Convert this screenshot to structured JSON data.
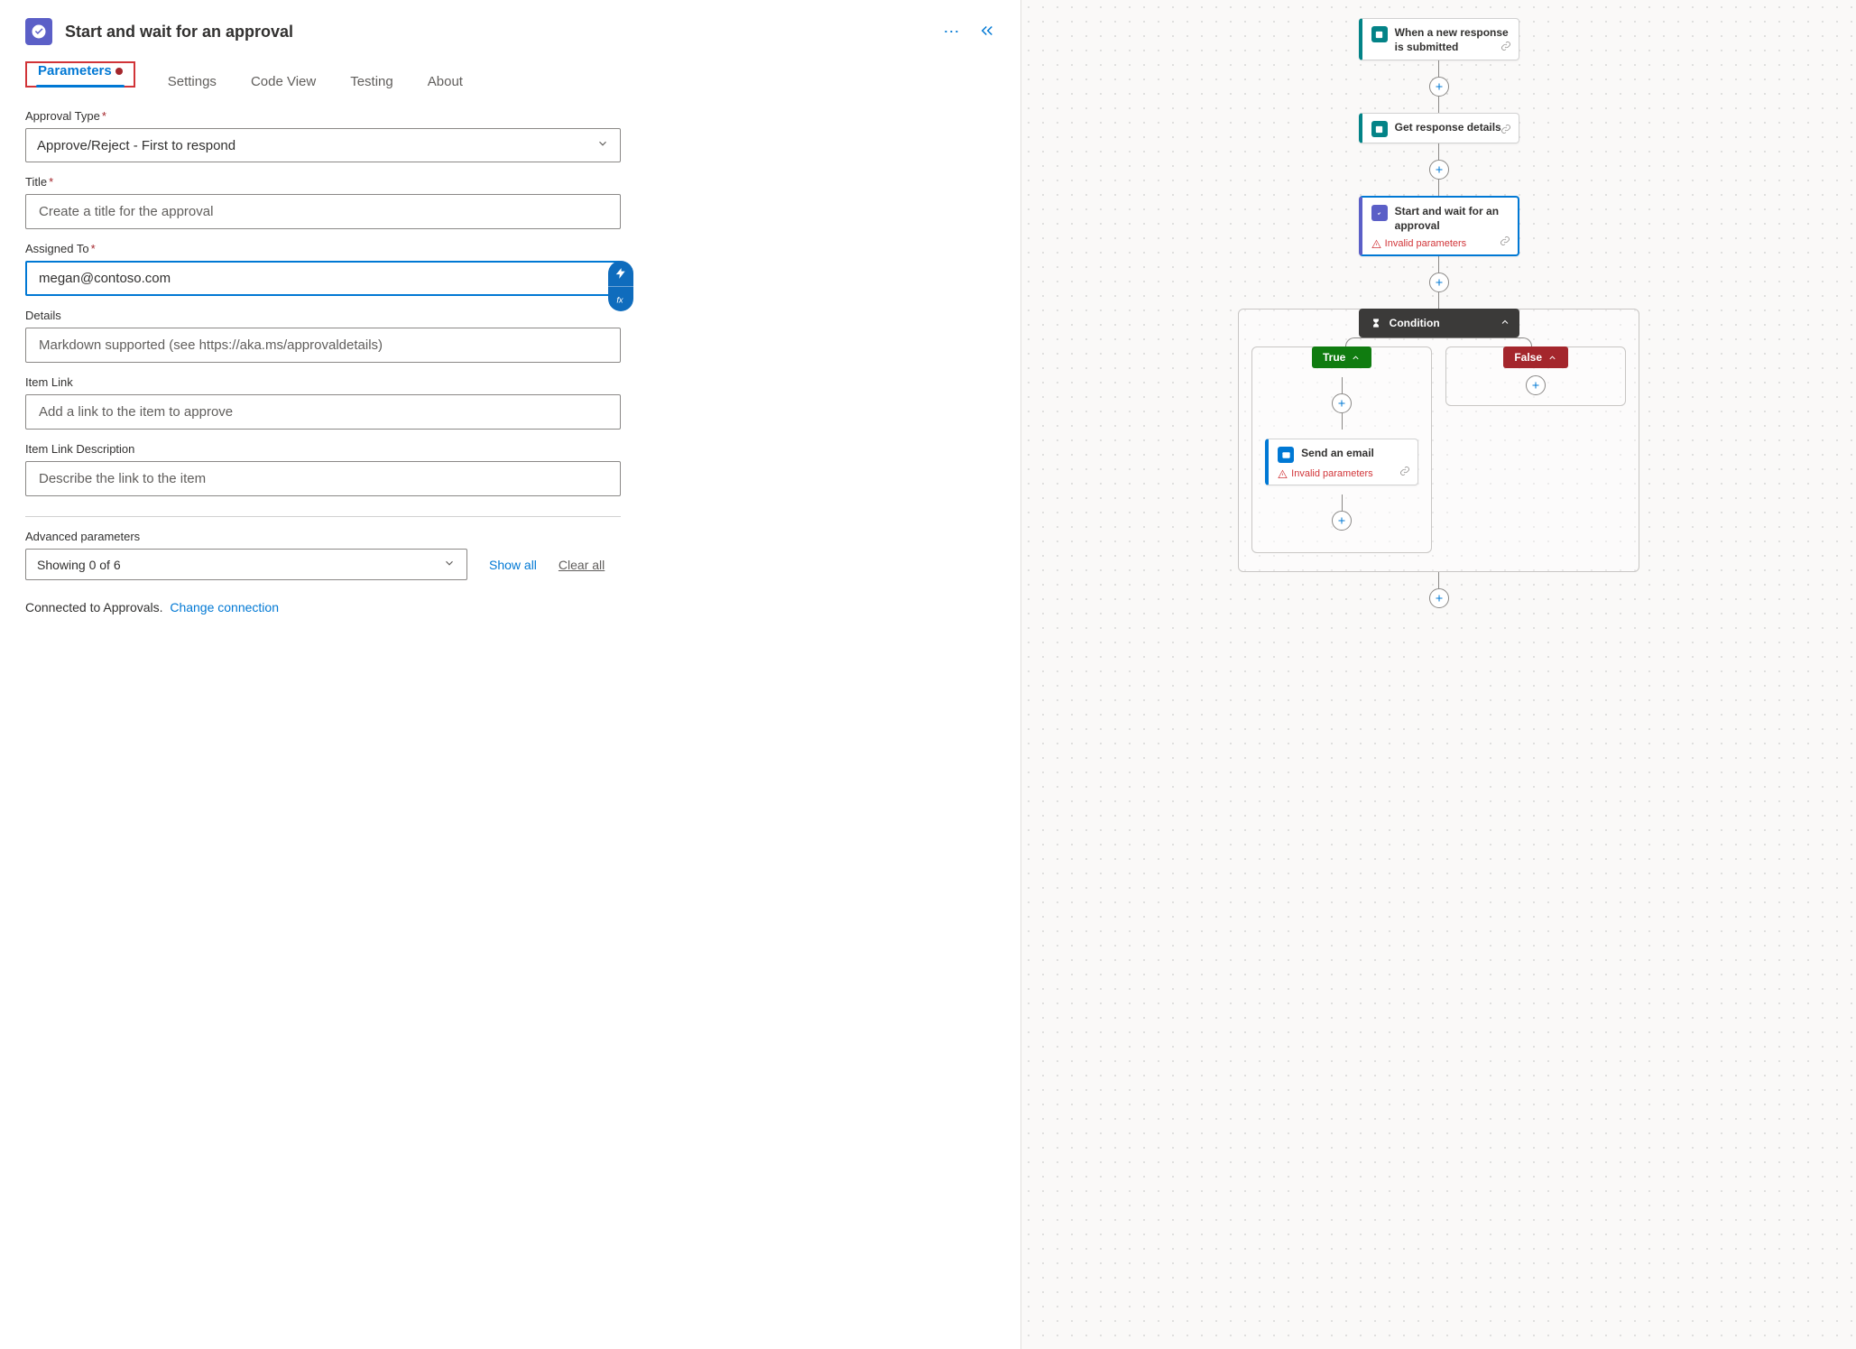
{
  "header": {
    "title": "Start and wait for an approval"
  },
  "tabs": {
    "parameters": "Parameters",
    "settings": "Settings",
    "codeview": "Code View",
    "testing": "Testing",
    "about": "About"
  },
  "fields": {
    "approvalType": {
      "label": "Approval Type",
      "value": "Approve/Reject - First to respond"
    },
    "title": {
      "label": "Title",
      "placeholder": "Create a title for the approval",
      "value": ""
    },
    "assignedTo": {
      "label": "Assigned To",
      "value": "megan@contoso.com"
    },
    "details": {
      "label": "Details",
      "placeholder": "Markdown supported (see https://aka.ms/approvaldetails)",
      "value": ""
    },
    "itemLink": {
      "label": "Item Link",
      "placeholder": "Add a link to the item to approve",
      "value": ""
    },
    "itemLinkDesc": {
      "label": "Item Link Description",
      "placeholder": "Describe the link to the item",
      "value": ""
    }
  },
  "advanced": {
    "label": "Advanced parameters",
    "showing": "Showing 0 of 6",
    "showAll": "Show all",
    "clearAll": "Clear all"
  },
  "connection": {
    "text": "Connected to Approvals.",
    "change": "Change connection"
  },
  "flow": {
    "step1": "When a new response is submitted",
    "step2": "Get response details",
    "step3": "Start and wait for an approval",
    "step3warn": "Invalid parameters",
    "condition": "Condition",
    "true": "True",
    "false": "False",
    "email": "Send an email",
    "emailwarn": "Invalid parameters"
  }
}
